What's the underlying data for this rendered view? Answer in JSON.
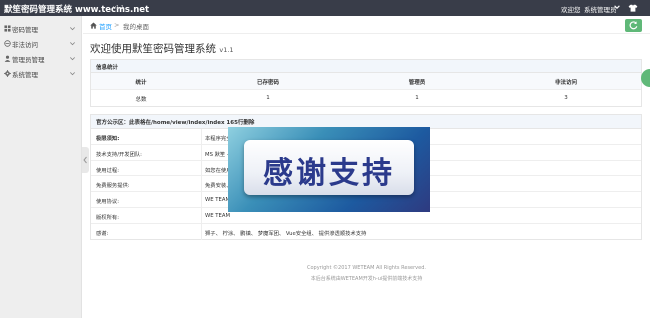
{
  "app": {
    "title": "默笙密码管理系统 www.tecms.net",
    "version": "v1.1",
    "welcome": "欢迎您",
    "user": "系统管理员"
  },
  "sidebar": {
    "items": [
      {
        "label": "密码管理",
        "icon": "grid-icon"
      },
      {
        "label": "非法访问",
        "icon": "ban-icon"
      },
      {
        "label": "管理员管理",
        "icon": "user-icon"
      },
      {
        "label": "系统管理",
        "icon": "gear-icon"
      }
    ]
  },
  "breadcrumb": {
    "home": "首页",
    "sep": ">",
    "current": "我的桌面"
  },
  "page": {
    "title": "欢迎使用默笙密码管理系统",
    "version": "v1.1"
  },
  "stats": {
    "title": "信息统计",
    "headers": [
      "统计",
      "已存密码",
      "管理员",
      "非法访问"
    ],
    "rows": [
      [
        "总数",
        "1",
        "1",
        "3"
      ]
    ]
  },
  "notice": {
    "title": "官方公示区：此表格在/home/view/index/index 165行删除",
    "rows": [
      {
        "label": "极限须知:",
        "value": "本程序完全",
        "bold": true
      },
      {
        "label": "技术支持/开发团队:",
        "value": "MS 默笙 - 技"
      },
      {
        "label": "使用过程:",
        "value": "如您在使用"
      },
      {
        "label": "免费服务提供:",
        "value": "免费安装、"
      },
      {
        "label": "使用协议:",
        "value": "WE TEAM"
      },
      {
        "label": "版权所有:",
        "value": "WE TEAM"
      },
      {
        "label": "感谢:",
        "value": "狮子、 柠涂、 鹏镇、 梦魔军团、 Vue安全组、 提供渗透顺技术支持"
      }
    ]
  },
  "footer": {
    "line1": "Copyright ©2017 WETEAM All Rights Reserved.",
    "line2": "本后台系统由WETEAM开发h-ui提供前端技术支持"
  },
  "overlay": {
    "text": "感谢支持"
  },
  "colors": {
    "topbar": "#393D49",
    "accent_green": "#5FB878",
    "link_blue": "#1E9FFF",
    "sidebar_bg": "#EEEEEE"
  }
}
